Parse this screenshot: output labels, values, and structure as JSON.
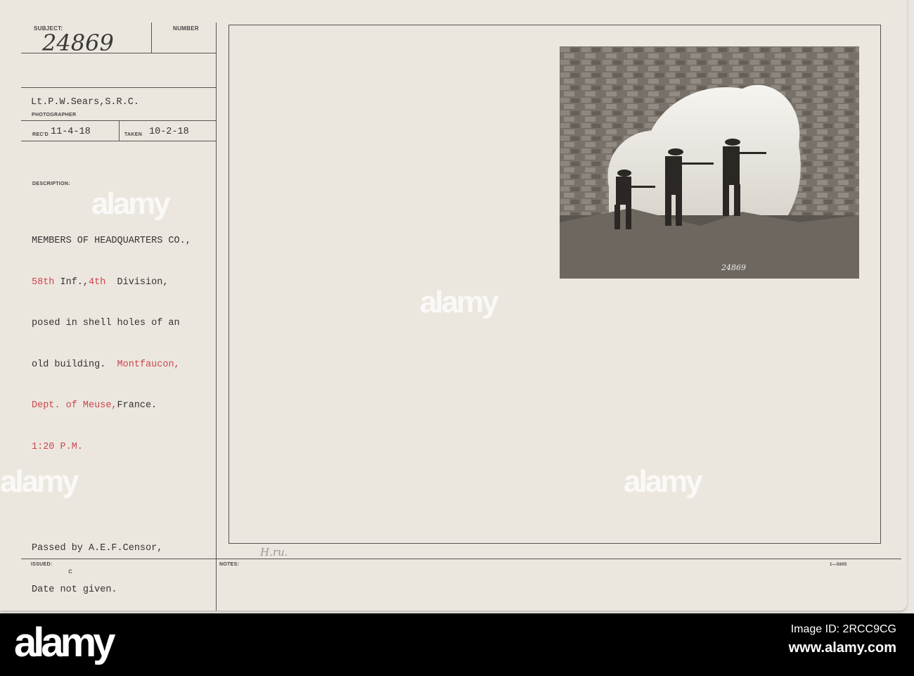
{
  "card": {
    "subject_label": "SUBJECT:",
    "subject_number": "24869",
    "number_label": "NUMBER",
    "photographer": "Lt.P.W.Sears,S.R.C.",
    "photographer_label": "PHOTOGRAPHER",
    "recd_label": "REC'D",
    "recd_date": "11-4-18",
    "taken_label": "TAKEN",
    "taken_date": "10-2-18",
    "description_label": "DESCRIPTION:",
    "description_lines": [
      "MEMBERS OF HEADQUARTERS CO.,",
      "58th Inf.,4th  Division,",
      "posed in shell holes of an",
      "old building.  Montfaucon,",
      "Dept. of Meuse,France.",
      "1:20 P.M."
    ],
    "description_parts": {
      "l2a": "58th",
      "l2b": " Inf.,",
      "l2c": "4th",
      "l2d": "  Division,",
      "l4a": "old building.  ",
      "l4b": "Montfaucon,",
      "l5a": "Dept. of Meuse,",
      "l5b": "France.",
      "l6": "1:20 P.M."
    },
    "censor_lines": [
      "Passed by A.E.F.Censor,",
      "Date not given."
    ],
    "issued_label": "ISSUED:",
    "issued_mark": "c",
    "notes_label": "NOTES:",
    "notes_handwriting": "H.ru.",
    "form_number": "1—5605",
    "photo_number": "24869"
  },
  "watermark": "alamy",
  "footer": {
    "logo": "alamy",
    "image_id": "Image ID: 2RCC9CG",
    "url": "www.alamy.com"
  },
  "colors": {
    "red_ink": "#c94650",
    "card": "#ece7de"
  }
}
